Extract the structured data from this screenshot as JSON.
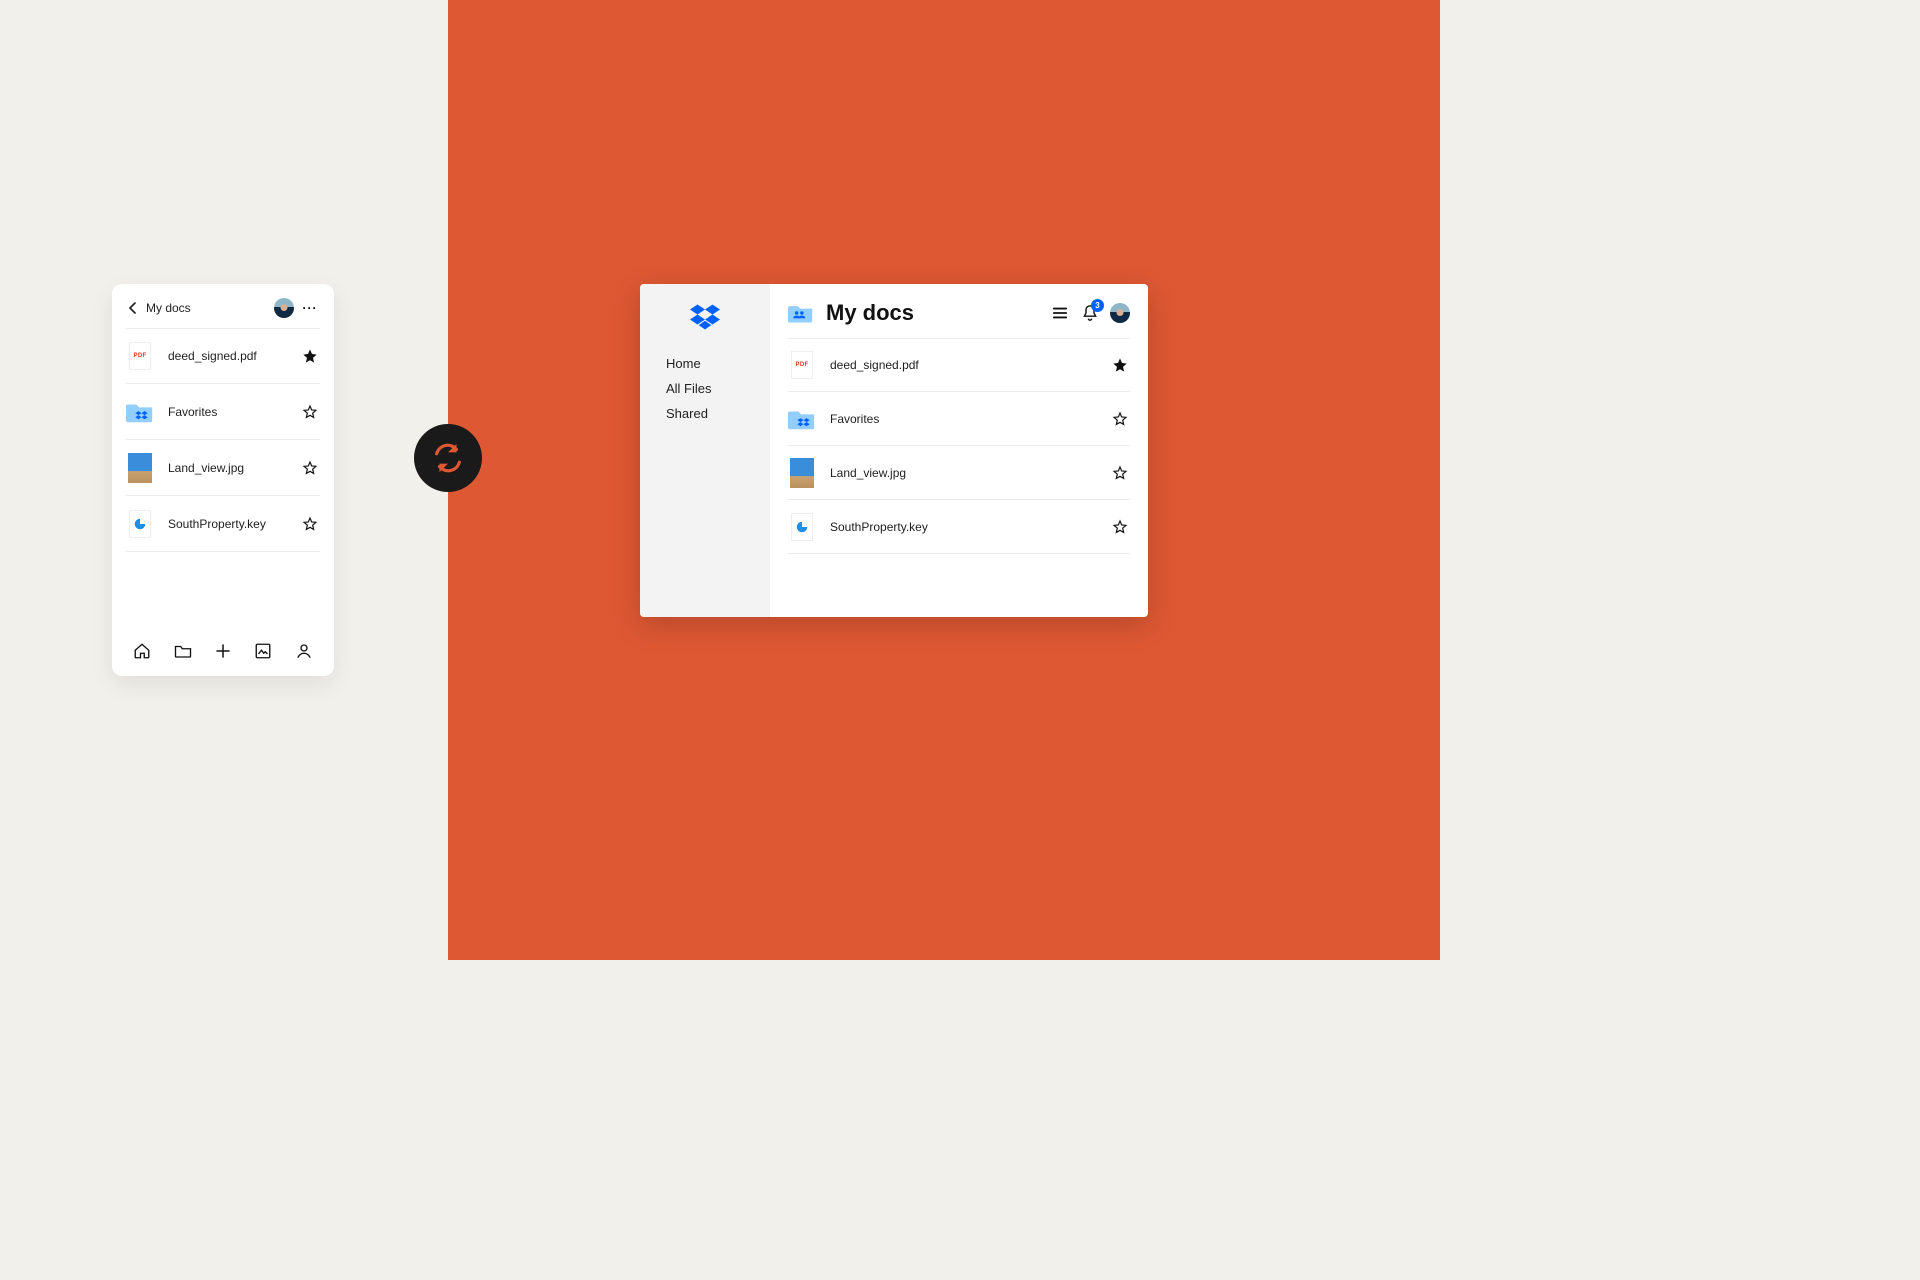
{
  "mobile": {
    "title": "My docs",
    "files": [
      {
        "name": "deed_signed.pdf",
        "starred": true,
        "type": "pdf",
        "icon": "pdf-icon",
        "pdf_label": "PDF"
      },
      {
        "name": "Favorites",
        "starred": false,
        "type": "folder",
        "icon": "folder-icon"
      },
      {
        "name": "Land_view.jpg",
        "starred": false,
        "type": "image",
        "icon": "image-icon"
      },
      {
        "name": "SouthProperty.key",
        "starred": false,
        "type": "key",
        "icon": "keynote-icon"
      }
    ],
    "nav": {
      "home": "home-icon",
      "files": "folder-icon",
      "add": "plus-icon",
      "photos": "photos-icon",
      "account": "person-icon"
    }
  },
  "desktop": {
    "title": "My docs",
    "notification_count": "3",
    "sidebar": [
      {
        "label": "Home"
      },
      {
        "label": "All Files"
      },
      {
        "label": "Shared"
      }
    ],
    "files": [
      {
        "name": "deed_signed.pdf",
        "starred": true,
        "type": "pdf",
        "pdf_label": "PDF"
      },
      {
        "name": "Favorites",
        "starred": false,
        "type": "folder"
      },
      {
        "name": "Land_view.jpg",
        "starred": false,
        "type": "image"
      },
      {
        "name": "SouthProperty.key",
        "starred": false,
        "type": "key"
      }
    ]
  },
  "sync": {
    "icon": "sync-icon"
  }
}
